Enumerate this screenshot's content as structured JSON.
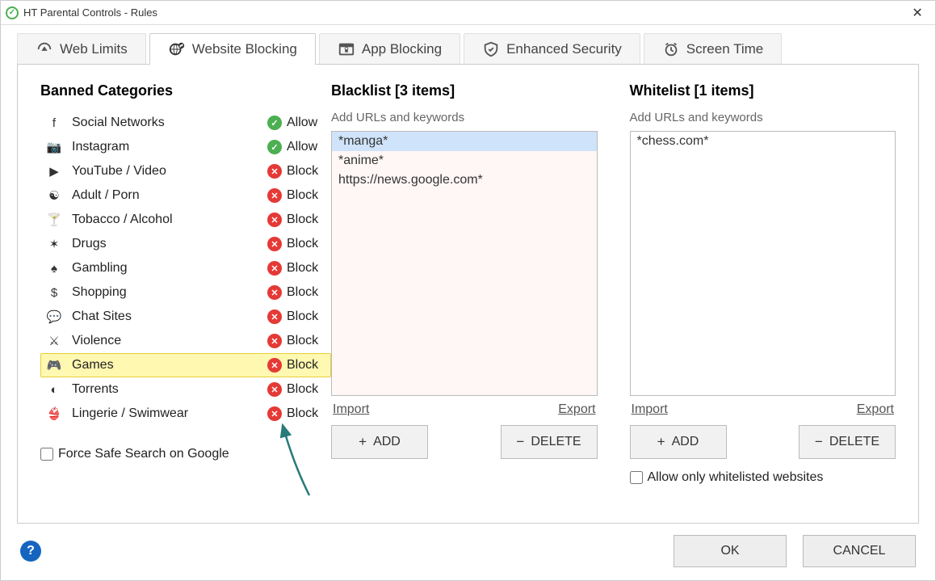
{
  "window": {
    "title": "HT Parental Controls - Rules"
  },
  "tabs": [
    {
      "label": "Web Limits",
      "active": false
    },
    {
      "label": "Website Blocking",
      "active": true
    },
    {
      "label": "App Blocking",
      "active": false
    },
    {
      "label": "Enhanced Security",
      "active": false
    },
    {
      "label": "Screen Time",
      "active": false
    }
  ],
  "categories": {
    "title": "Banned Categories",
    "items": [
      {
        "icon": "f",
        "name": "Social Networks",
        "status": "Allow"
      },
      {
        "icon": "📷",
        "name": "Instagram",
        "status": "Allow"
      },
      {
        "icon": "▶",
        "name": "YouTube / Video",
        "status": "Block"
      },
      {
        "icon": "☯",
        "name": "Adult / Porn",
        "status": "Block"
      },
      {
        "icon": "🍸",
        "name": "Tobacco / Alcohol",
        "status": "Block"
      },
      {
        "icon": "✶",
        "name": "Drugs",
        "status": "Block"
      },
      {
        "icon": "♠",
        "name": "Gambling",
        "status": "Block"
      },
      {
        "icon": "$",
        "name": "Shopping",
        "status": "Block"
      },
      {
        "icon": "💬",
        "name": "Chat Sites",
        "status": "Block"
      },
      {
        "icon": "⚔",
        "name": "Violence",
        "status": "Block"
      },
      {
        "icon": "🎮",
        "name": "Games",
        "status": "Block",
        "highlight": true
      },
      {
        "icon": "◐",
        "name": "Torrents",
        "status": "Block"
      },
      {
        "icon": "👙",
        "name": "Lingerie / Swimwear",
        "status": "Block"
      }
    ],
    "force_safe_label": "Force Safe Search on Google"
  },
  "blacklist": {
    "title": "Blacklist [3 items]",
    "hint": "Add URLs and keywords",
    "items": [
      "*manga*",
      "*anime*",
      "https://news.google.com*"
    ],
    "selected_index": 0,
    "import": "Import",
    "export": "Export",
    "add": "ADD",
    "delete": "DELETE"
  },
  "whitelist": {
    "title": "Whitelist [1 items]",
    "hint": "Add URLs and keywords",
    "items": [
      "*chess.com*"
    ],
    "import": "Import",
    "export": "Export",
    "add": "ADD",
    "delete": "DELETE",
    "only_whitelist_label": "Allow only whitelisted websites"
  },
  "buttons": {
    "ok": "OK",
    "cancel": "CANCEL"
  }
}
